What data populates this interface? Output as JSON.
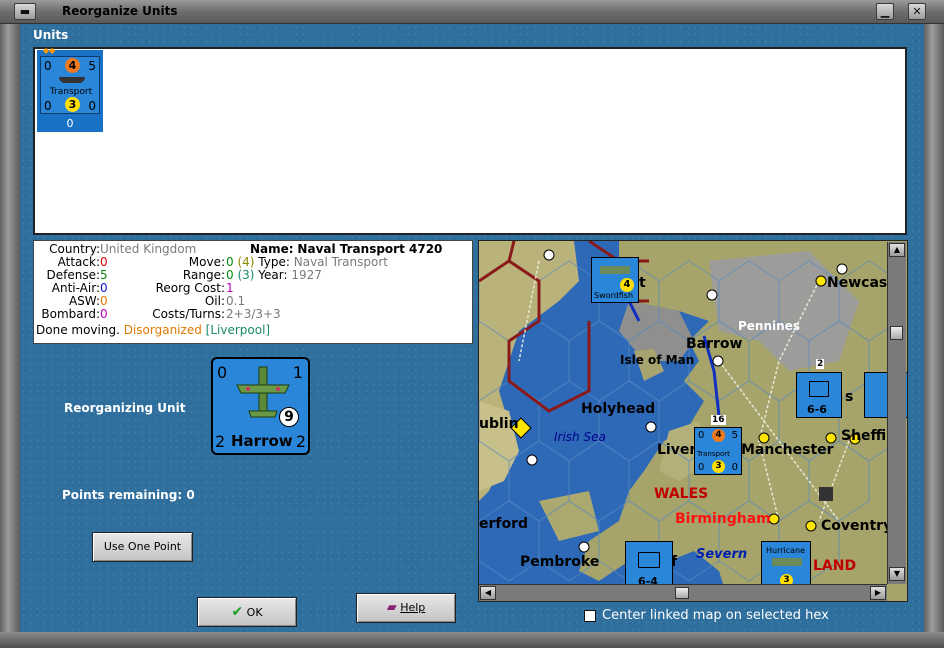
{
  "window": {
    "title": "Reorganize Units"
  },
  "units_section": {
    "label": "Units",
    "tiles": [
      {
        "attack": "0",
        "move": "4",
        "defense_right": "5",
        "name": "Transport",
        "bottom_left": "0",
        "bottom_mid": "3",
        "bottom_right": "0",
        "below": "0"
      }
    ]
  },
  "info": {
    "country_label": "Country:",
    "country": "United Kingdom",
    "attack_label": "Attack:",
    "attack": "0",
    "defense_label": "Defense:",
    "defense": "5",
    "antiair_label": "Anti-Air:",
    "antiair": "0",
    "asw_label": "ASW:",
    "asw": "0",
    "bombard_label": "Bombard:",
    "bombard": "0",
    "done_moving": "Done moving.",
    "status": "Disorganized",
    "location": "[Liverpool]",
    "name_label": "Name:",
    "name": "Naval Transport 4720",
    "move_label": "Move:",
    "move": "0",
    "move_paren": "(4)",
    "type_label": "Type:",
    "type": "Naval Transport",
    "range_label": "Range:",
    "range": "0",
    "range_paren": "(3)",
    "year_label": "Year:",
    "year": "1927",
    "reorg_label": "Reorg Cost:",
    "reorg": "1",
    "oil_label": "Oil:",
    "oil": "0.1",
    "costs_label": "Costs/Turns:",
    "costs": "2+3/3+3"
  },
  "reorganizing": {
    "label": "Reorganizing Unit",
    "counter": {
      "tl": "0",
      "tr": "1",
      "bl": "2",
      "br": "2",
      "name": "Harrow",
      "circle": "9"
    }
  },
  "points": {
    "label": "Points remaining:",
    "value": "0"
  },
  "buttons": {
    "use_point": "Use One Point",
    "ok": "OK",
    "help": "Help"
  },
  "map": {
    "labels": [
      "Newcast",
      "Pennines",
      "Barrow",
      "Isle of Man",
      "Holyhead",
      "ublin",
      "Irish Sea",
      "Liver",
      "Manchester",
      "Sheffi",
      "WALES",
      "Birmingham",
      "erford",
      "Coventry",
      "Pembroke",
      "Severn",
      "LAND",
      "s",
      "t",
      "f"
    ],
    "unit_counters": [
      {
        "name": "Swordfish",
        "value": "4"
      },
      {
        "name": "Transport",
        "top": "0",
        "mid": "4",
        "right": "5",
        "bl": "0",
        "bm": "3",
        "br": "0",
        "stack": "16"
      },
      {
        "name": "XXX",
        "value": "6-6",
        "stack": "2"
      },
      {
        "name": "XXX",
        "value": "6-4"
      },
      {
        "name": "Hurricane",
        "value": "3"
      }
    ]
  },
  "center_linked": {
    "label": "Center linked map on selected hex",
    "checked": false
  },
  "icons": {
    "ok": "checkmark-icon",
    "help": "book-icon",
    "close": "close-icon"
  },
  "colors": {
    "background": "#2f6f9e",
    "selected_tile": "#1a72c6",
    "disorganized": "#e07a00"
  }
}
